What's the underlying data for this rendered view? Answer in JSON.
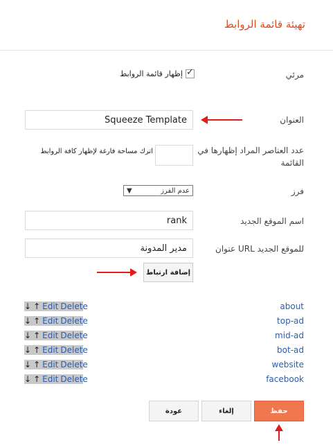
{
  "header": {
    "title": "تهيئة قائمة الروابط"
  },
  "visible": {
    "label": "مرئي",
    "checkbox_label": "إظهار قائمة الروابط",
    "checked": true
  },
  "title_field": {
    "label": "العنوان",
    "value": "Squeeze Template"
  },
  "count_field": {
    "label_line1": "عدد العناصر المراد إظهارها في",
    "label_line2": "القائمة",
    "hint": "اترك مساحة فارغة لإظهار كافة الروابط",
    "value": ""
  },
  "sort_field": {
    "label": "فرز",
    "selected": "عدم الفرز",
    "caret": "▼"
  },
  "new_site_name": {
    "label": "اسم الموقع الجديد",
    "value": "rank"
  },
  "new_site_url": {
    "label": "عنوان URL للموقع الجديد",
    "value": "مدير المدونة"
  },
  "add_link_button": {
    "label": "إضافة ارتباط"
  },
  "row_controls": {
    "down": "↓",
    "up": "↑",
    "edit": "Edit",
    "delete": "Delete"
  },
  "links": [
    {
      "name": "about"
    },
    {
      "name": "top-ad"
    },
    {
      "name": "mid-ad"
    },
    {
      "name": "bot-ad"
    },
    {
      "name": "website"
    },
    {
      "name": "facebook"
    }
  ],
  "footer": {
    "save_label": "حفظ",
    "cancel_label": "إلغاء",
    "back_label": "عودة"
  },
  "colors": {
    "accent": "#dd4b26",
    "save": "#f0764e",
    "arrow": "#e21b1b",
    "link": "#2a5db0"
  }
}
